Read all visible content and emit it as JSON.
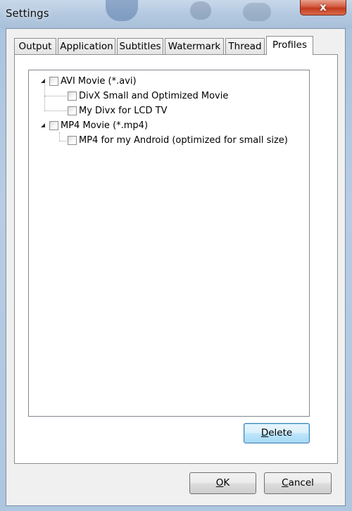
{
  "window": {
    "title": "Settings",
    "close_label": "x"
  },
  "tabs": [
    {
      "label": "Output",
      "active": false
    },
    {
      "label": "Application",
      "active": false
    },
    {
      "label": "Subtitles",
      "active": false
    },
    {
      "label": "Watermark",
      "active": false
    },
    {
      "label": "Thread",
      "active": false
    },
    {
      "label": "Profiles",
      "active": true
    }
  ],
  "tree": {
    "nodes": [
      {
        "label": "AVI Movie (*.avi)",
        "checked": false,
        "expanded": true,
        "children": [
          {
            "label": "DivX Small and Optimized Movie",
            "checked": false
          },
          {
            "label": "My Divx for LCD TV",
            "checked": false
          }
        ]
      },
      {
        "label": "MP4 Movie (*.mp4)",
        "checked": false,
        "expanded": true,
        "children": [
          {
            "label": "MP4 for my Android (optimized for small size)",
            "checked": false
          }
        ]
      }
    ]
  },
  "buttons": {
    "delete": {
      "accel": "D",
      "rest": "elete"
    },
    "ok": {
      "accel": "O",
      "rest": "K"
    },
    "cancel": {
      "accel": "C",
      "rest": "ancel"
    }
  }
}
